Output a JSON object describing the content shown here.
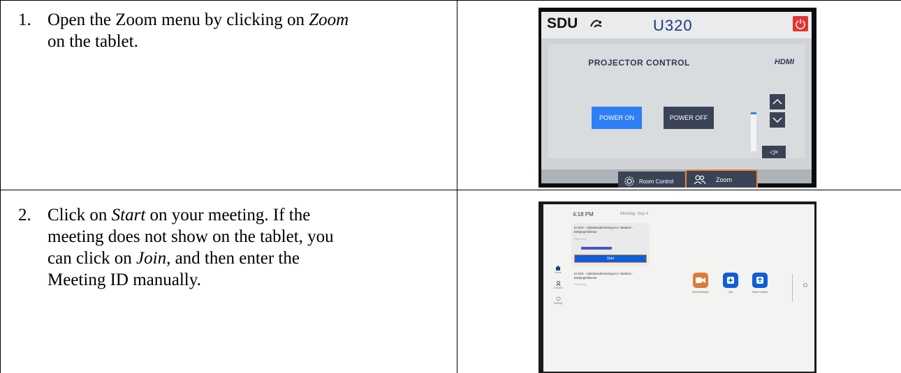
{
  "steps": [
    {
      "number": "1.",
      "line1_a": "Open the Zoom menu by clicking on ",
      "line1_em": "Zoom",
      "line2": "on the tablet."
    },
    {
      "number": "2.",
      "line1": "Click on ",
      "line1_em": "Start",
      "line1_b": " on your meeting. If the",
      "line2": "meeting does not show on the tablet, you",
      "line3_a": "can click on ",
      "line3_em": "Join",
      "line3_b": ", and then enter the",
      "line4": "Meeting ID manually."
    }
  ],
  "photo1": {
    "logo": "SDU",
    "title": "U320",
    "section_title": "PROJECTOR CONTROL",
    "source": "HDMI",
    "power_on": "POWER ON",
    "power_off": "POWER OFF",
    "mute": "◁×",
    "tab_room": "Room Control",
    "tab_zoom": "Zoom",
    "colors": {
      "accent": "#2e7ef7",
      "highlight": "#e88a3a",
      "power": "#e33434"
    }
  },
  "photo2": {
    "time": "4:18 PM",
    "date": "Monday, Sep 4",
    "meeting1": "KI E23 - Hybridundervisning KA i Medicin - Esbjerg/Odense",
    "recurring": "Recurring",
    "start": "Start",
    "meeting2": "KI E23 - Hybridundervisning KA i Medicin - Esbjerg/Odense",
    "nav": [
      "Home",
      "Contacts",
      "Settings"
    ],
    "actions": [
      "New Meeting ▾",
      "Join",
      "Share Content"
    ],
    "colors": {
      "zoom_blue": "#0e5ed8",
      "new_meeting": "#e07a3a"
    }
  }
}
